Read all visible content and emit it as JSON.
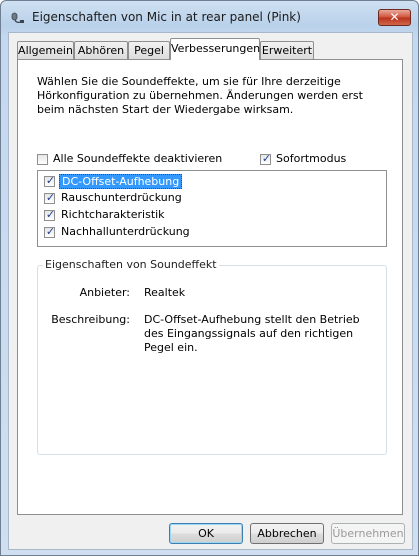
{
  "window": {
    "title": "Eigenschaften von Mic in at rear panel (Pink)",
    "close_label": "✕"
  },
  "tabs": [
    {
      "label": "Allgemein",
      "active": false
    },
    {
      "label": "Abhören",
      "active": false
    },
    {
      "label": "Pegel",
      "active": false
    },
    {
      "label": "Verbesserungen",
      "active": true
    },
    {
      "label": "Erweitert",
      "active": false
    }
  ],
  "enhancements": {
    "description": "Wählen Sie die Soundeffekte, um sie für Ihre derzeitige Hörkonfiguration zu übernehmen. Änderungen werden erst beim nächsten Start der Wiedergabe wirksam.",
    "disable_all": {
      "label": "Alle Soundeffekte deaktivieren",
      "checked": false
    },
    "immediate_mode": {
      "label": "Sofortmodus",
      "checked": true
    },
    "effects": [
      {
        "label": "DC-Offset-Aufhebung",
        "checked": true,
        "selected": true
      },
      {
        "label": "Rauschunterdrückung",
        "checked": true,
        "selected": false
      },
      {
        "label": "Richtcharakteristik",
        "checked": true,
        "selected": false
      },
      {
        "label": "Nachhallunterdrückung",
        "checked": true,
        "selected": false
      }
    ]
  },
  "properties": {
    "group_title": "Eigenschaften von Soundeffekt",
    "provider_label": "Anbieter:",
    "provider_value": "Realtek",
    "description_label": "Beschreibung:",
    "description_value": "DC-Offset-Aufhebung stellt den Betrieb des Eingangssignals auf den richtigen Pegel ein."
  },
  "buttons": {
    "ok": "OK",
    "cancel": "Abbrechen",
    "apply": "Übernehmen"
  },
  "colors": {
    "selection": "#3399ff",
    "close_button": "#c9452f",
    "check": "#1f3f8f"
  }
}
